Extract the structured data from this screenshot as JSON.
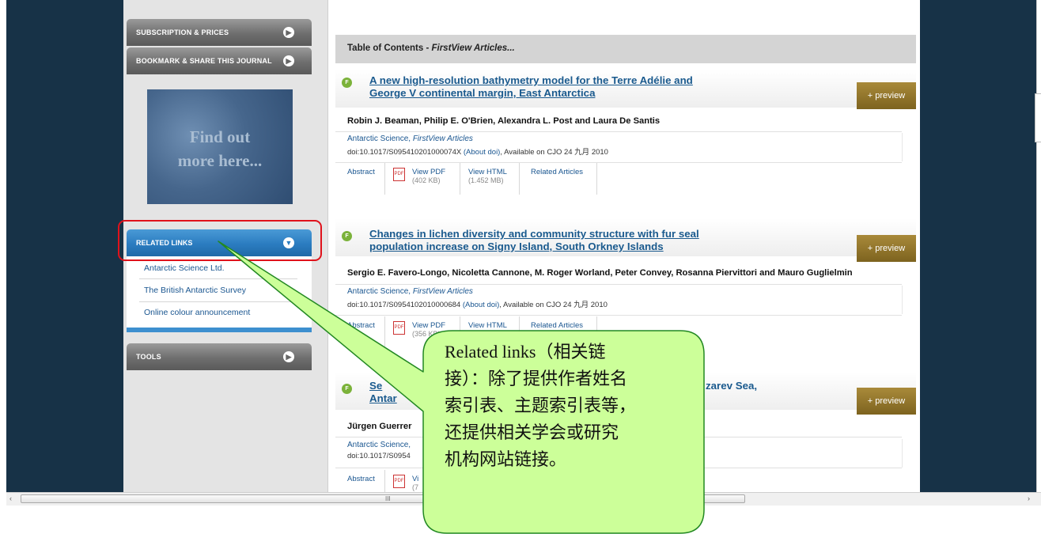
{
  "sidebar": {
    "subscription_label": "SUBSCRIPTION & PRICES",
    "bookmark_label": "BOOKMARK & SHARE THIS JOURNAL",
    "promo_line1": "Find out",
    "promo_line2": "more here...",
    "related_links_label": "RELATED LINKS",
    "related_links": [
      "Antarctic Science Ltd.",
      "The British Antarctic Survey",
      "Online colour announcement"
    ],
    "tools_label": "TOOLS"
  },
  "toc": {
    "title_prefix": "Table of Contents - ",
    "title_italic": "FirstView Articles..."
  },
  "articles": [
    {
      "badge": "F",
      "title_line1": "A new high-resolution bathymetry model for the Terre Adélie and",
      "title_line2": "George V continental margin, East Antarctica",
      "preview": "+ preview",
      "authors": "Robin J. Beaman, Philip E. O'Brien, Alexandra L. Post and Laura De Santis",
      "journal": "Antarctic Science, ",
      "journal_italic": "FirstView Articles",
      "doi": "doi:10.1017/S095410201000074X ",
      "about_doi": "(About doi)",
      "available": ", Available on CJO 24 九月 2010",
      "abstract": "Abstract",
      "view_pdf": "View PDF",
      "pdf_size": "(402 KB)",
      "view_html": "View HTML",
      "html_size": "(1.452 MB)",
      "related": "Related Articles"
    },
    {
      "badge": "F",
      "title_line1": "Changes in lichen diversity and community structure with fur seal",
      "title_line2": "population increase on Signy Island, South Orkney Islands",
      "preview": "+ preview",
      "authors": "Sergio E. Favero-Longo, Nicoletta Cannone, M. Roger Worland, Peter Convey, Rosanna Piervittori and Mauro Guglielmin",
      "journal": "Antarctic Science, ",
      "journal_italic": "FirstView Articles",
      "doi": "doi:10.1017/S0954102010000684 ",
      "about_doi": "(About doi)",
      "available": ", Available on CJO 24 九月 2010",
      "abstract": "Abstract",
      "view_pdf": "View PDF",
      "pdf_size": "(356 KB)",
      "view_html": "View HTML",
      "related": "Related Articles"
    },
    {
      "badge": "F",
      "title_line1_start": "Se",
      "title_line1_end": "zarev Sea,",
      "title_line2": "Antar",
      "preview": "+ preview",
      "authors": "Jürgen Guerrer",
      "journal": "Antarctic Science,",
      "doi": "doi:10.1017/S0954",
      "abstract": "Abstract",
      "view_pdf_partial": "Vi",
      "pdf_size_partial": "(7"
    }
  ],
  "callout": {
    "lines": [
      "Related links（相关链",
      "接）：除了提供作者姓名",
      "索引表、主题索引表等，",
      "还提供相关学会或研究",
      "机构网站链接。"
    ]
  },
  "scrollbar": {
    "left_arrow": "‹",
    "right_arrow": "›",
    "grip": "III"
  },
  "colors": {
    "page_bg": "#173247",
    "link": "#1a5690",
    "title_link": "#1a5a8e",
    "preview_btn": "#8f7428",
    "related_header": "#2b7cc0",
    "callout_fill": "#ccff99",
    "callout_border": "#228822",
    "highlight_box": "#e0121b"
  }
}
